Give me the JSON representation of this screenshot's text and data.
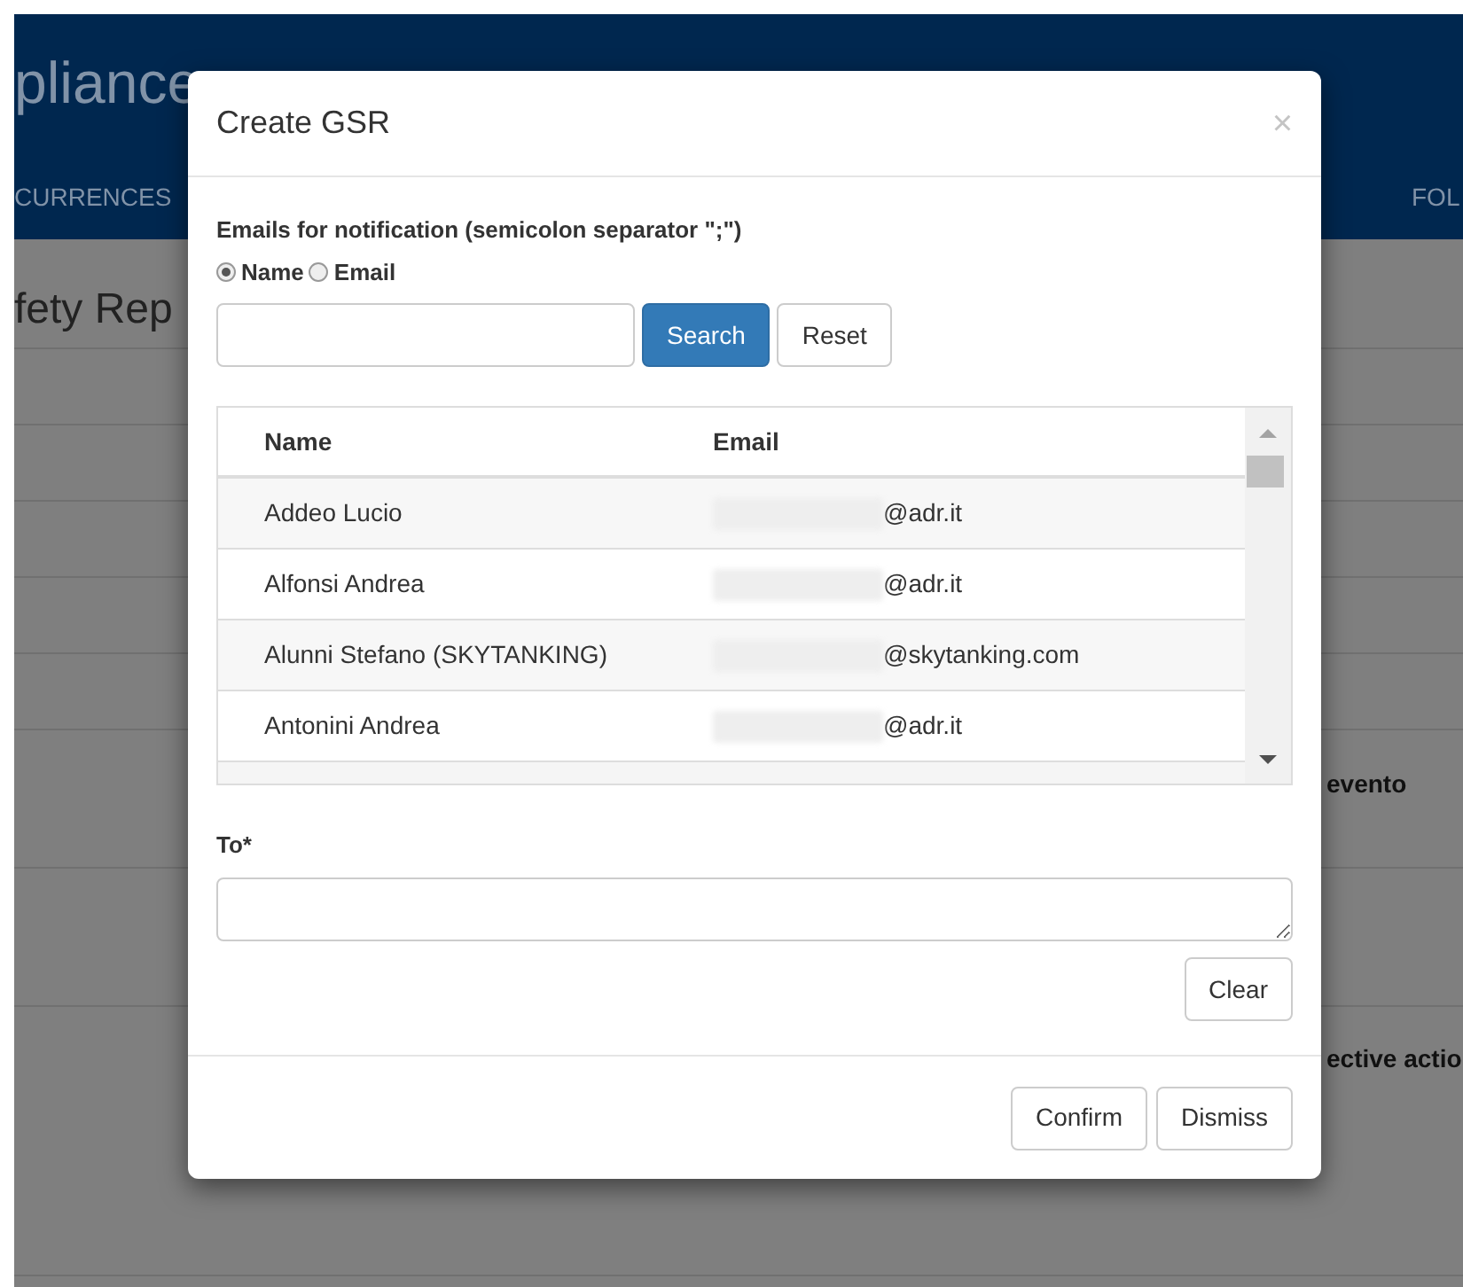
{
  "app_title": "pliance",
  "nav": [
    {
      "label": "CURRENCES"
    },
    {
      "label": "FOL"
    }
  ],
  "page_heading": "fety Rep",
  "background_labels": [
    {
      "label": "evento"
    },
    {
      "label": "ective actio"
    }
  ],
  "dialog": {
    "title": "Create GSR",
    "close": "×",
    "recipients_label": "Emails for notification (semicolon separator \";\")",
    "search_by": [
      {
        "label": "Name",
        "selected": true
      },
      {
        "label": "Email",
        "selected": false
      }
    ],
    "search_buttons": [
      {
        "label": "Search",
        "kind": "primary"
      },
      {
        "label": "Reset",
        "kind": "default"
      }
    ],
    "table": {
      "columns": [
        "Name",
        "Email"
      ],
      "rows": [
        {
          "name": "Addeo Lucio",
          "email": "@adr.it"
        },
        {
          "name": "Alfonsi Andrea",
          "email": "@adr.it"
        },
        {
          "name": "Alunni Stefano (SKYTANKING)",
          "email": "@skytanking.com"
        },
        {
          "name": "Antonini Andrea",
          "email": "@adr.it"
        }
      ]
    },
    "to_label": "To*",
    "clear_button": "Clear",
    "footer_buttons": [
      "Confirm",
      "Dismiss"
    ]
  }
}
